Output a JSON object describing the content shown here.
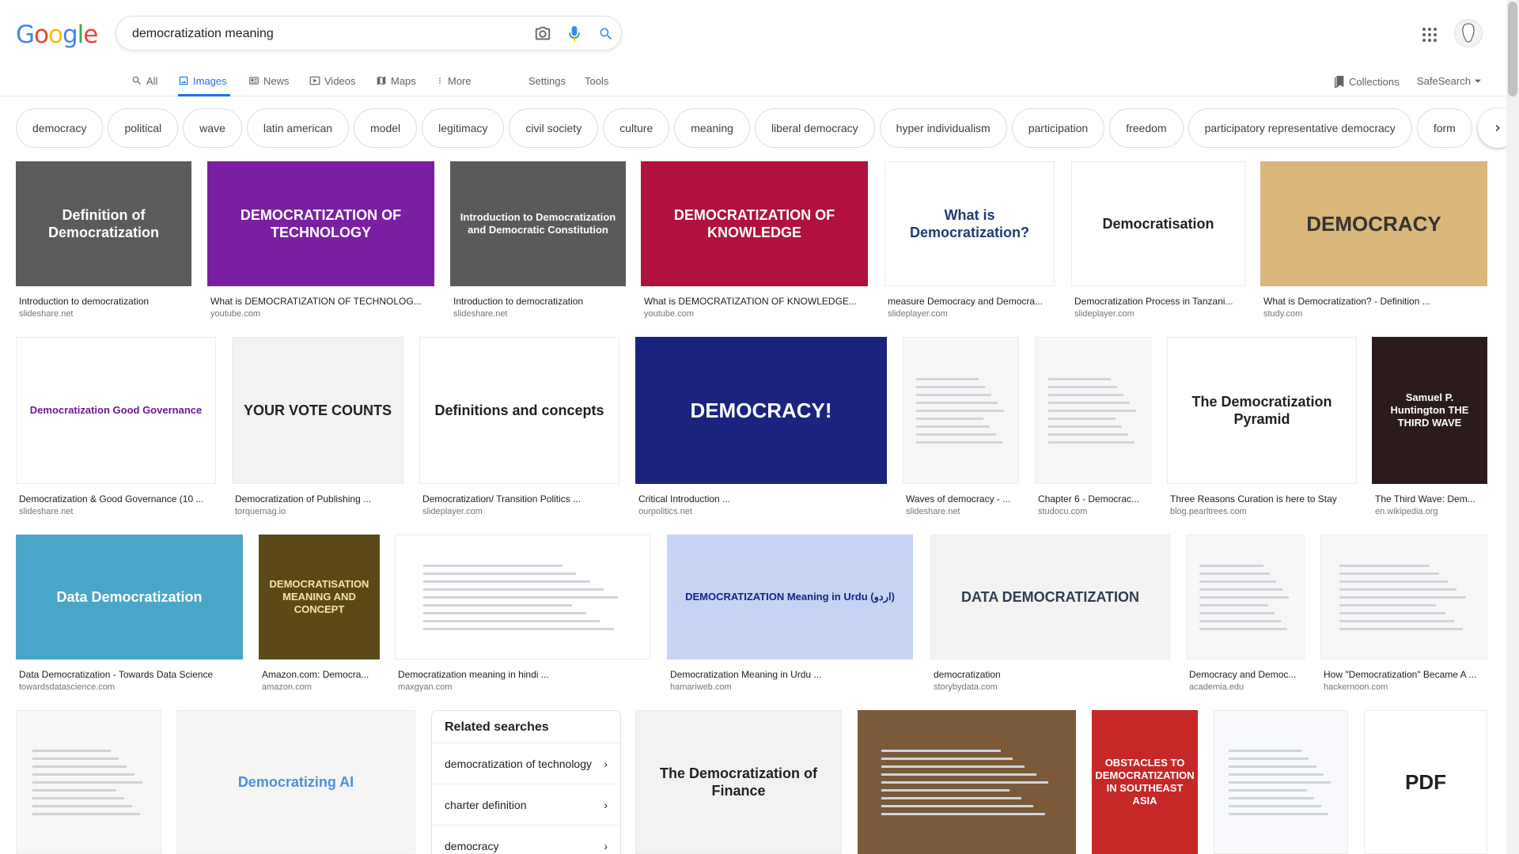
{
  "logo": {
    "letters": [
      "G",
      "o",
      "o",
      "g",
      "l",
      "e"
    ],
    "colors": [
      "#4285f4",
      "#ea4335",
      "#fbbc05",
      "#4285f4",
      "#34a853",
      "#ea4335"
    ]
  },
  "search": {
    "query": "democratization meaning",
    "icons": [
      "camera-icon",
      "microphone-icon",
      "search-icon"
    ]
  },
  "header_right": {
    "apps_icon": "apps-grid-icon",
    "avatar": "user-avatar"
  },
  "nav": {
    "tabs": [
      {
        "label": "All",
        "icon": "search-icon"
      },
      {
        "label": "Images",
        "icon": "image-icon",
        "active": true
      },
      {
        "label": "News",
        "icon": "news-icon"
      },
      {
        "label": "Videos",
        "icon": "video-icon"
      },
      {
        "label": "Maps",
        "icon": "map-icon"
      },
      {
        "label": "More",
        "icon": "more-vert-icon"
      }
    ],
    "settings": "Settings",
    "tools": "Tools",
    "collections": "Collections",
    "safesearch": "SafeSearch"
  },
  "chips": [
    "democracy",
    "political",
    "wave",
    "latin american",
    "model",
    "legitimacy",
    "civil society",
    "culture",
    "meaning",
    "liberal democracy",
    "hyper individualism",
    "participation",
    "freedom",
    "participatory representative democracy",
    "form"
  ],
  "results": [
    {
      "title": "Introduction to democratization",
      "source": "slideshare.net",
      "thumb": "Definition of Democratization",
      "bg": "#5b5b5b",
      "fg": "#ffffff"
    },
    {
      "title": "What is DEMOCRATIZATION OF TECHNOLOG...",
      "source": "youtube.com",
      "thumb": "DEMOCRATIZATION OF TECHNOLOGY",
      "bg": "#7a1fa2",
      "fg": "#ffffff"
    },
    {
      "title": "Introduction to democratization",
      "source": "slideshare.net",
      "thumb": "Introduction to Democratization and Democratic Constitution",
      "bg": "#5a5a5a",
      "fg": "#ffffff"
    },
    {
      "title": "What is DEMOCRATIZATION OF KNOWLEDGE...",
      "source": "youtube.com",
      "thumb": "DEMOCRATIZATION OF KNOWLEDGE",
      "bg": "#b0123d",
      "fg": "#ffffff"
    },
    {
      "title": "measure Democracy and Democra...",
      "source": "slideplayer.com",
      "thumb": "What is Democratization?",
      "bg": "#ffffff",
      "fg": "#1f3b73"
    },
    {
      "title": "Democratization Process in Tanzani...",
      "source": "slideplayer.com",
      "thumb": "Democratisation",
      "bg": "#ffffff",
      "fg": "#202124"
    },
    {
      "title": "What is Democratization? - Definition ...",
      "source": "study.com",
      "thumb": "DEMOCRACY",
      "bg": "#d9b77a",
      "fg": "#333333"
    },
    {
      "title": "Democratization & Good Governance (10 ...",
      "source": "slideshare.net",
      "thumb": "Democratization Good Governance",
      "bg": "#ffffff",
      "fg": "#6a1b9a"
    },
    {
      "title": "Democratization of Publishing ...",
      "source": "torquemag.io",
      "thumb": "YOUR VOTE COUNTS",
      "bg": "#f3f3f3",
      "fg": "#202124"
    },
    {
      "title": "Democratization/ Transition Politics ...",
      "source": "slideplayer.com",
      "thumb": "Definitions and concepts",
      "bg": "#ffffff",
      "fg": "#202124"
    },
    {
      "title": "Critical Introduction ...",
      "source": "ourpolitics.net",
      "thumb": "DEMOCRACY!",
      "bg": "#1a237e",
      "fg": "#ffffff"
    },
    {
      "title": "Waves of democracy - ...",
      "source": "slideshare.net",
      "thumb": "",
      "bg": "#f7f7f7",
      "fg": "#555555"
    },
    {
      "title": "Chapter 6 - Democrac...",
      "source": "studocu.com",
      "thumb": "",
      "bg": "#f7f7f7",
      "fg": "#555555"
    },
    {
      "title": "Three Reasons Curation is here to Stay",
      "source": "blog.pearltrees.com",
      "thumb": "The Democratization Pyramid",
      "bg": "#ffffff",
      "fg": "#202124"
    },
    {
      "title": "The Third Wave: Dem...",
      "source": "en.wikipedia.org",
      "thumb": "Samuel P. Huntington THE THIRD WAVE",
      "bg": "#2b1b1b",
      "fg": "#ffffff"
    },
    {
      "title": "Data Democratization - Towards Data Science",
      "source": "towardsdatascience.com",
      "thumb": "Data Democratization",
      "bg": "#4aa6c8",
      "fg": "#ffffff"
    },
    {
      "title": "Amazon.com: Democra...",
      "source": "amazon.com",
      "thumb": "DEMOCRATISATION MEANING AND CONCEPT",
      "bg": "#5b4a18",
      "fg": "#f5e6a8"
    },
    {
      "title": "Democratization meaning in hindi ...",
      "source": "maxgyan.com",
      "thumb": "",
      "bg": "#ffffff",
      "fg": "#555555"
    },
    {
      "title": "Democratization Meaning in Urdu ...",
      "source": "hamariweb.com",
      "thumb": "DEMOCRATIZATION Meaning in Urdu (اردو)",
      "bg": "#c5d4f5",
      "fg": "#1a237e"
    },
    {
      "title": "democratization",
      "source": "storybydata.com",
      "thumb": "DATA DEMOCRATIZATION",
      "bg": "#f3f3f3",
      "fg": "#2d3e50"
    },
    {
      "title": "Democracy and Democ...",
      "source": "academia.edu",
      "thumb": "",
      "bg": "#f7f7f7",
      "fg": "#555555"
    },
    {
      "title": "How \"Democratization\" Became A ...",
      "source": "hackernoon.com",
      "thumb": "",
      "bg": "#f7f7f7",
      "fg": "#555555"
    },
    {
      "title": "",
      "source": "",
      "thumb": "",
      "bg": "#f7f7f7",
      "fg": "#555555"
    },
    {
      "title": "",
      "source": "",
      "thumb": "Democratizing AI",
      "bg": "#f5f5f5",
      "fg": "#4a90d9"
    },
    {
      "title": "",
      "source": "",
      "thumb": "The Democratization of Finance",
      "bg": "#f2f2f2",
      "fg": "#202124"
    },
    {
      "title": "",
      "source": "",
      "thumb": "",
      "bg": "#7a5a3a",
      "fg": "#ffffff"
    },
    {
      "title": "",
      "source": "",
      "thumb": "OBSTACLES TO DEMOCRATIZATION IN SOUTHEAST ASIA",
      "bg": "#c62828",
      "fg": "#ffffff"
    },
    {
      "title": "",
      "source": "",
      "thumb": "",
      "bg": "#f7f9fc",
      "fg": "#1565c0"
    },
    {
      "title": "",
      "source": "",
      "thumb": "PDF",
      "bg": "#ffffff",
      "fg": "#202124"
    }
  ],
  "related_searches": {
    "heading": "Related searches",
    "items": [
      "democratization of technology",
      "charter definition",
      "democracy"
    ]
  }
}
